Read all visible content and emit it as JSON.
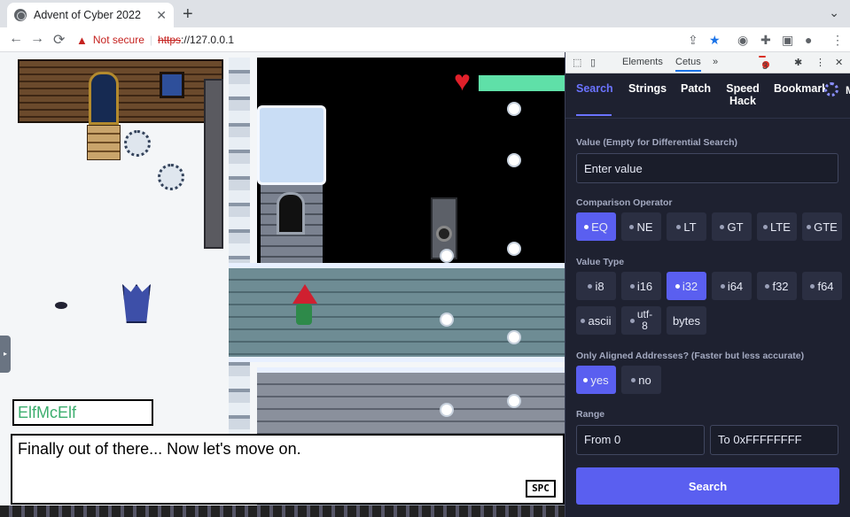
{
  "browser": {
    "tab_title": "Advent of Cyber 2022",
    "tab_close": "✕",
    "new_tab": "+",
    "tabs_menu": "⌄",
    "nav": {
      "back": "←",
      "forward": "→",
      "reload": "⟳"
    },
    "omnibox": {
      "warning_icon": "▲",
      "not_secure": "Not secure",
      "separator": "|",
      "scheme": "https",
      "host": "://127.0.0.1"
    },
    "toolbar_icons": {
      "share": "⇪",
      "star": "★",
      "extension_a": "◉",
      "extensions": "✚",
      "side_panel": "▣",
      "profile": "●",
      "menu": "⋮"
    }
  },
  "game": {
    "speaker_name": "ElfMcElf",
    "dialog_text": "Finally out of there... Now let's move on.",
    "dialog_key": "SPC",
    "side_handle": "▸"
  },
  "devtools": {
    "panel_tabs": {
      "elements": "Elements",
      "cetus": "Cetus",
      "more": "»"
    },
    "error_count": "3",
    "icons": {
      "inspect": "⬚",
      "device": "▯",
      "settings": "✱",
      "menu": "⋮",
      "close": "✕"
    }
  },
  "cetus": {
    "tabs": [
      {
        "label": "Search",
        "active": true
      },
      {
        "label": "Strings",
        "active": false
      },
      {
        "label": "Patch",
        "active": false
      },
      {
        "label": "Speed\nHack",
        "active": false
      },
      {
        "label": "Bookmarks",
        "active": false
      }
    ],
    "cut_label": "M",
    "value_label": "Value (Empty for Differential Search)",
    "value_placeholder": "Enter value",
    "comparison_label": "Comparison Operator",
    "comparison_options": [
      "EQ",
      "NE",
      "LT",
      "GT",
      "LTE",
      "GTE"
    ],
    "comparison_selected": "EQ",
    "type_label": "Value Type",
    "type_options_row1": [
      "i8",
      "i16",
      "i32",
      "i64",
      "f32",
      "f64"
    ],
    "type_options_row2": [
      "ascii",
      "utf-8",
      "bytes"
    ],
    "type_selected": "i32",
    "aligned_label": "Only Aligned Addresses? (Faster but less accurate)",
    "aligned_options": [
      "yes",
      "no"
    ],
    "aligned_selected": "yes",
    "range_label": "Range",
    "range_from": "From 0",
    "range_to": "To 0xFFFFFFFF",
    "search_button": "Search"
  }
}
